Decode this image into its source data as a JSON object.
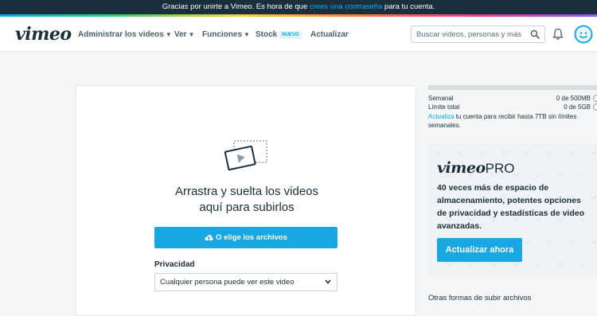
{
  "banner": {
    "text_before": "Gracias por unirte a Vimeo. Es hora de que ",
    "link": "crees una contraseña",
    "text_after": " para tu cuenta."
  },
  "nav": {
    "logo": "vimeo",
    "items": [
      {
        "label": "Administrar los videos",
        "has_caret": true
      },
      {
        "label": "Ver",
        "has_caret": true
      },
      {
        "label": "Funciones",
        "has_caret": true
      },
      {
        "label": "Stock",
        "badge": "NUEVO"
      },
      {
        "label": "Actualizar"
      }
    ],
    "search_placeholder": "Buscar videos, personas y más",
    "icons": [
      "search-icon",
      "bell-icon",
      "avatar-icon"
    ]
  },
  "upload": {
    "drop_line1": "Arrastra y suelta los videos",
    "drop_line2": "aquí para subirlos",
    "choose_button": "O elige los archivos",
    "privacy_label": "Privacidad",
    "privacy_value": "Cualquier persona puede ver este video"
  },
  "sidebar": {
    "weekly_label": "Semanal",
    "weekly_value": "0 de 500MB",
    "total_label": "Límite total",
    "total_value": "0 de 5GB",
    "upgrade_link": "Actualiza",
    "upgrade_text": " tu cuenta para recibir hasta 7TB sin límites semanales.",
    "pro": {
      "logo_main": "vimeo",
      "logo_suffix": "PRO",
      "description": "40 veces más de espacio de almacenamiento, potentes opciones de privacidad y estadísticas de video avanzadas.",
      "button": "Actualizar ahora"
    },
    "other_ways": "Otras formas de subir archivos"
  },
  "colors": {
    "accent": "#17a8e3",
    "dark": "#1a2e3b",
    "banner_bg": "#1a2e3b"
  }
}
